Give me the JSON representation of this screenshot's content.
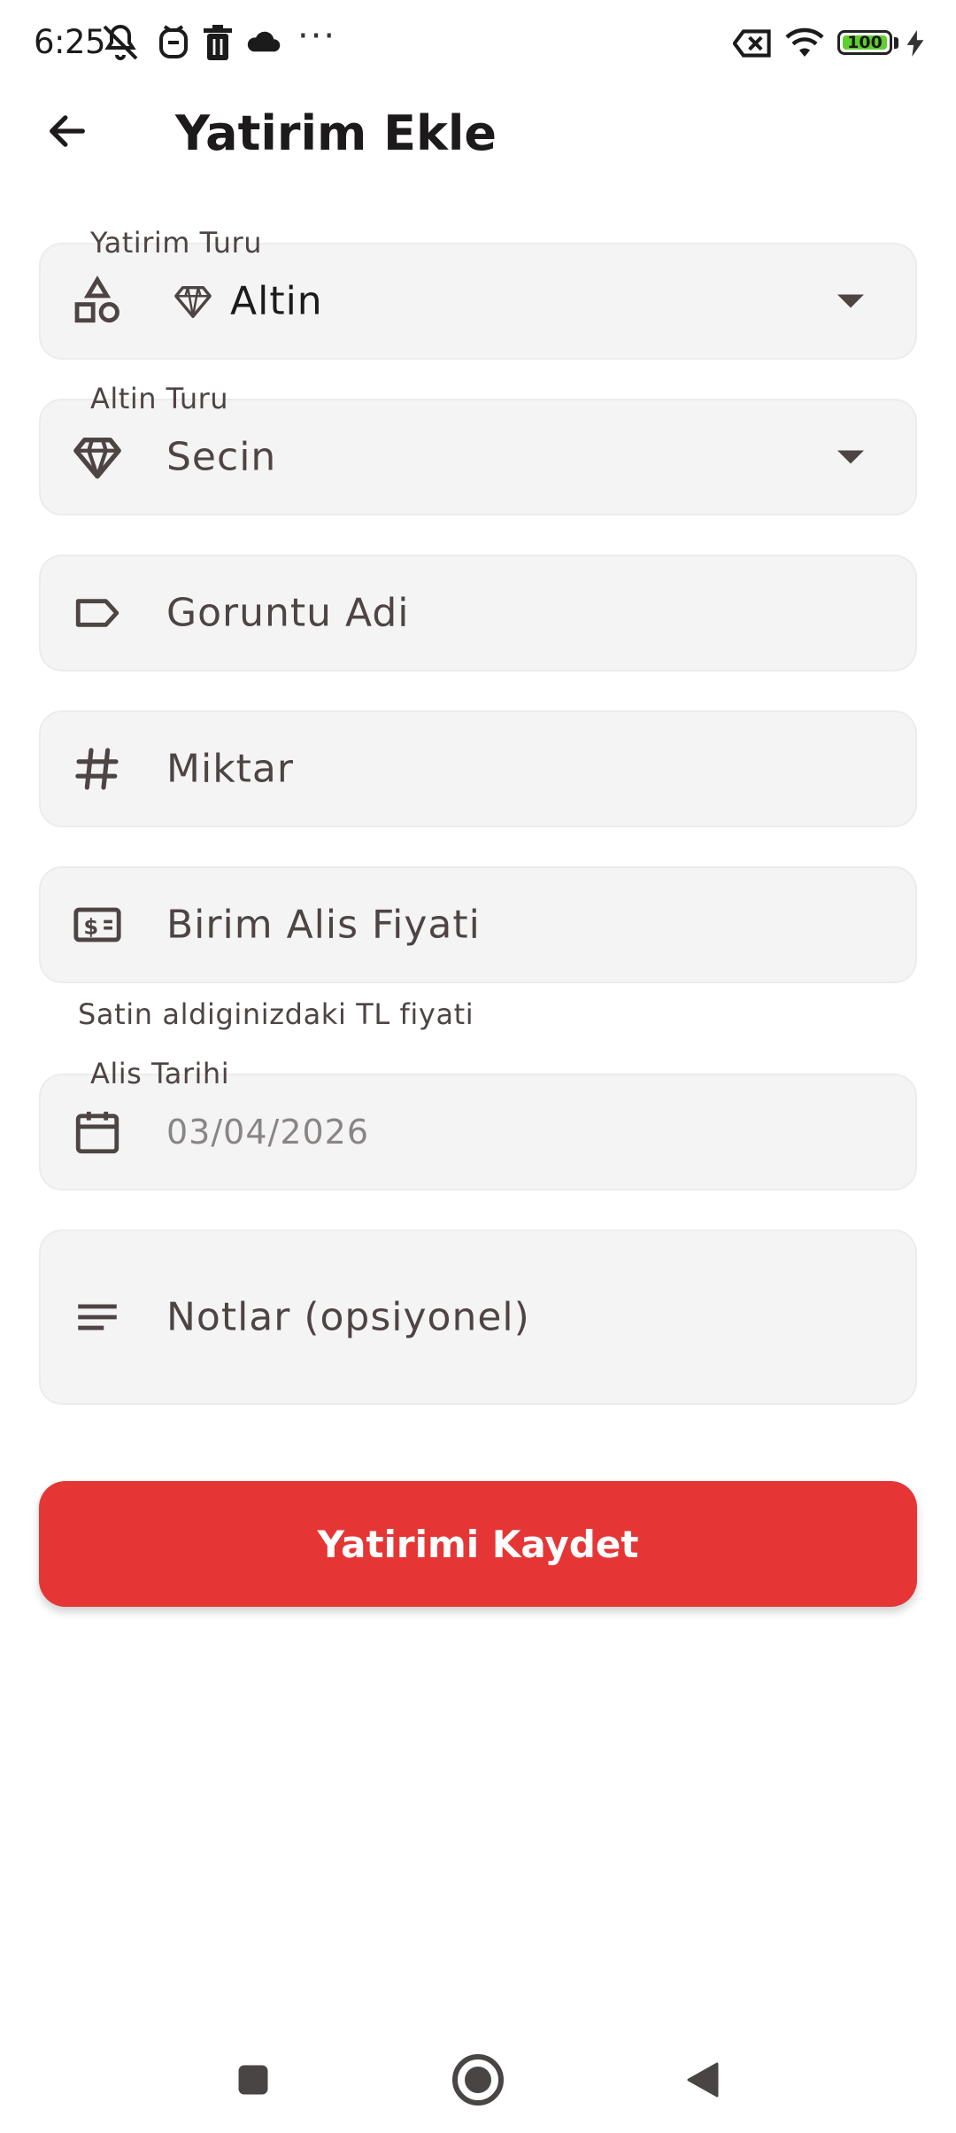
{
  "status_bar": {
    "time": "6:25",
    "overflow": "···",
    "battery_level": "100",
    "icons": [
      "notifications-muted-icon",
      "alarm-icon",
      "trash-icon",
      "cloud-icon",
      "data-off-icon",
      "wifi-icon",
      "battery-icon",
      "charging-icon"
    ]
  },
  "app_bar": {
    "title": "Yatirim Ekle",
    "back_icon": "arrow-left-icon"
  },
  "form": {
    "investment_type": {
      "label": "Yatirim Turu",
      "value": "Altin",
      "icon": "shapes-icon",
      "value_icon": "gem-icon"
    },
    "gold_type": {
      "label": "Altin Turu",
      "value": "Secin",
      "icon": "diamond-icon"
    },
    "display_name": {
      "placeholder": "Goruntu Adi",
      "icon": "label-tag-icon"
    },
    "amount": {
      "placeholder": "Miktar",
      "icon": "hash-icon"
    },
    "unit_price": {
      "placeholder": "Birim Alis Fiyati",
      "helper": "Satin aldiginizdaki TL fiyati",
      "icon": "price-tag-icon"
    },
    "purchase_date": {
      "label": "Alis Tarihi",
      "value": "03/04/2026",
      "icon": "calendar-icon"
    },
    "notes": {
      "placeholder": "Notlar (opsiyonel)",
      "icon": "notes-lines-icon"
    }
  },
  "save_button": {
    "label": "Yatirimi Kaydet"
  },
  "colors": {
    "accent": "#e53635",
    "field_bg": "#f4f4f4",
    "text": "#4e4444"
  },
  "nav_bar": {
    "buttons": [
      "recents-icon",
      "home-icon",
      "back-triangle-icon"
    ]
  }
}
